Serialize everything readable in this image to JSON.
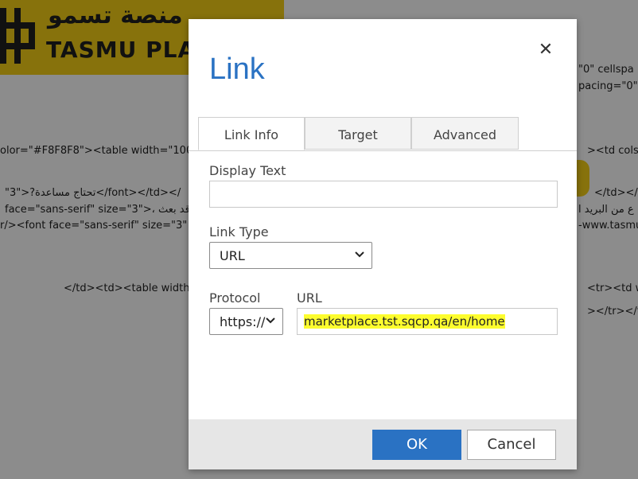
{
  "background": {
    "logo_arabic": "منصة تسمو",
    "logo_english": "TASMU PLAT",
    "code_lines": [
      {
        "text": "\"0\" cellspa"
      },
      {
        "text": "pacing=\"0\""
      },
      {
        "text": "olor=\"#F8F8F8\"><table width=\"100"
      },
      {
        "text": "><td colspa"
      },
      {
        "text": "\"3\">?تحتاج مساعدة</font></td></"
      },
      {
        "text": "</td></"
      },
      {
        "text": "face=\"sans-serif\" size=\"3\">، قد بعث"
      },
      {
        "text": "ع من البريد ا"
      },
      {
        "text": "r/><font face=\"sans-serif\" size=\"3\""
      },
      {
        "text": "-www.tasmu"
      },
      {
        "text": "</td><td><table width"
      },
      {
        "text": "<tr><td w"
      },
      {
        "text": "></tr></ta"
      }
    ]
  },
  "dialog": {
    "title": "Link",
    "close_symbol": "✕",
    "tabs": [
      {
        "label": "Link Info",
        "active": true
      },
      {
        "label": "Target",
        "active": false
      },
      {
        "label": "Advanced",
        "active": false
      }
    ],
    "display_text": {
      "label": "Display Text",
      "value": ""
    },
    "link_type": {
      "label": "Link Type",
      "value": "URL"
    },
    "protocol": {
      "label": "Protocol",
      "value": "https://"
    },
    "url": {
      "label": "URL",
      "value": "marketplace.tst.sqcp.qa/en/home"
    },
    "buttons": {
      "ok": "OK",
      "cancel": "Cancel"
    }
  },
  "colors": {
    "accent": "#2a72c3",
    "highlight": "#fdfd2e",
    "brand_yellow": "#f6cf16"
  }
}
